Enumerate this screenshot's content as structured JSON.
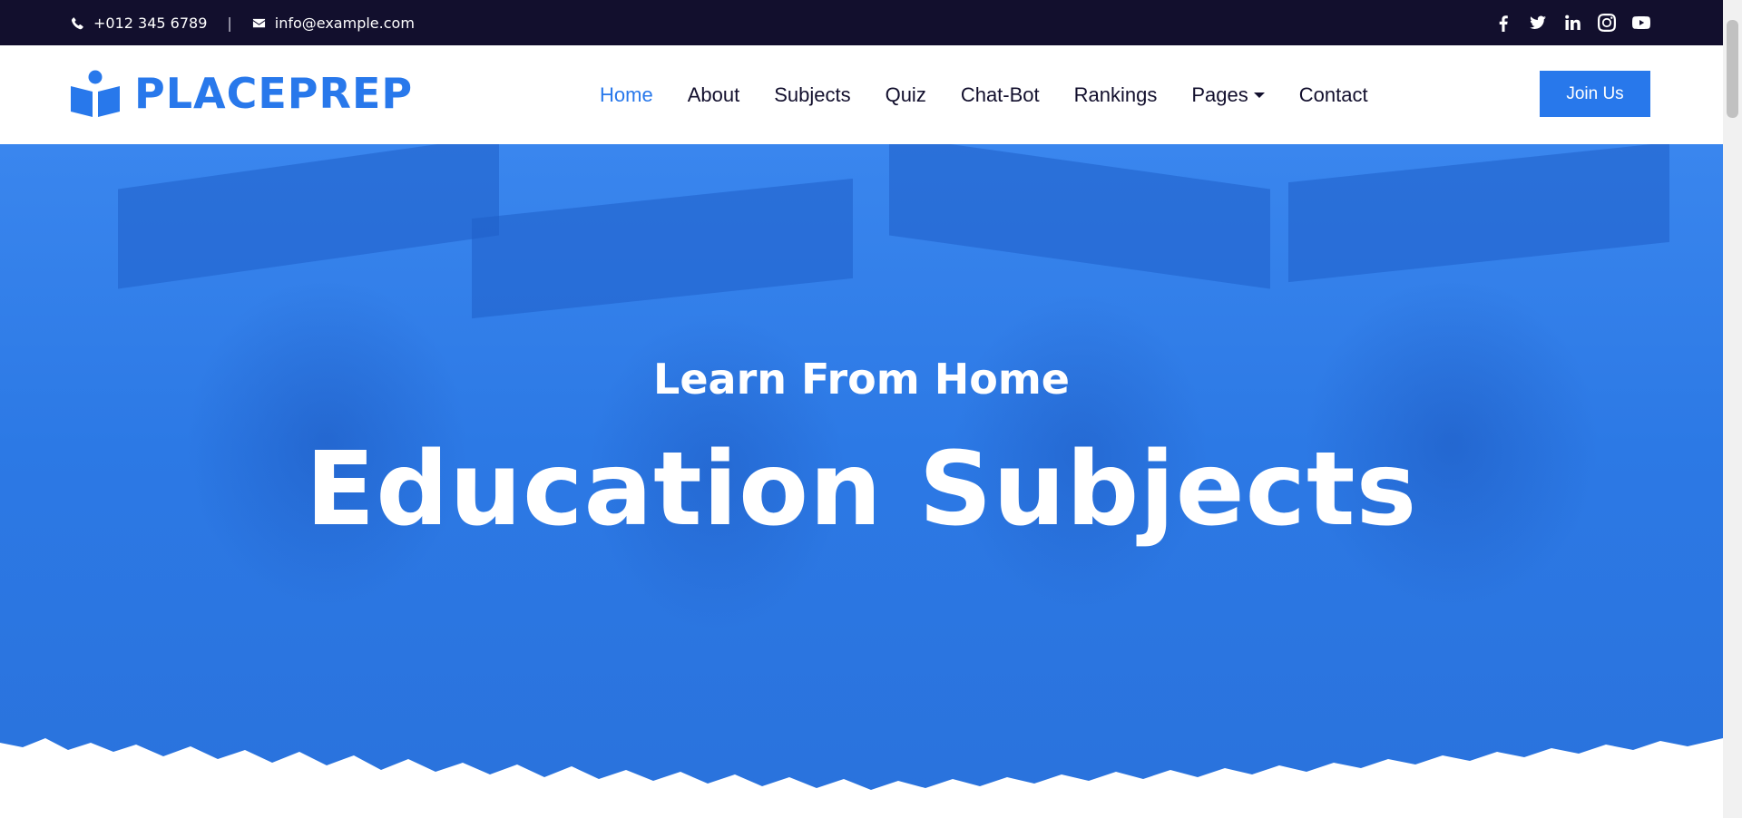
{
  "topbar": {
    "phone": "+012 345 6789",
    "email": "info@example.com",
    "separator": "|",
    "social_icons": [
      "facebook-icon",
      "twitter-icon",
      "linkedin-icon",
      "instagram-icon",
      "youtube-icon"
    ]
  },
  "navbar": {
    "brand": "PLACEPREP",
    "menu": [
      {
        "label": "Home",
        "active": true
      },
      {
        "label": "About"
      },
      {
        "label": "Subjects"
      },
      {
        "label": "Quiz"
      },
      {
        "label": "Chat-Bot"
      },
      {
        "label": "Rankings"
      },
      {
        "label": "Pages",
        "dropdown": true
      },
      {
        "label": "Contact"
      }
    ],
    "join_label": "Join Us"
  },
  "hero": {
    "subtitle": "Learn From Home",
    "title": "Education Subjects"
  },
  "colors": {
    "primary": "#2878eb",
    "dark": "#120f2d",
    "white": "#ffffff"
  }
}
